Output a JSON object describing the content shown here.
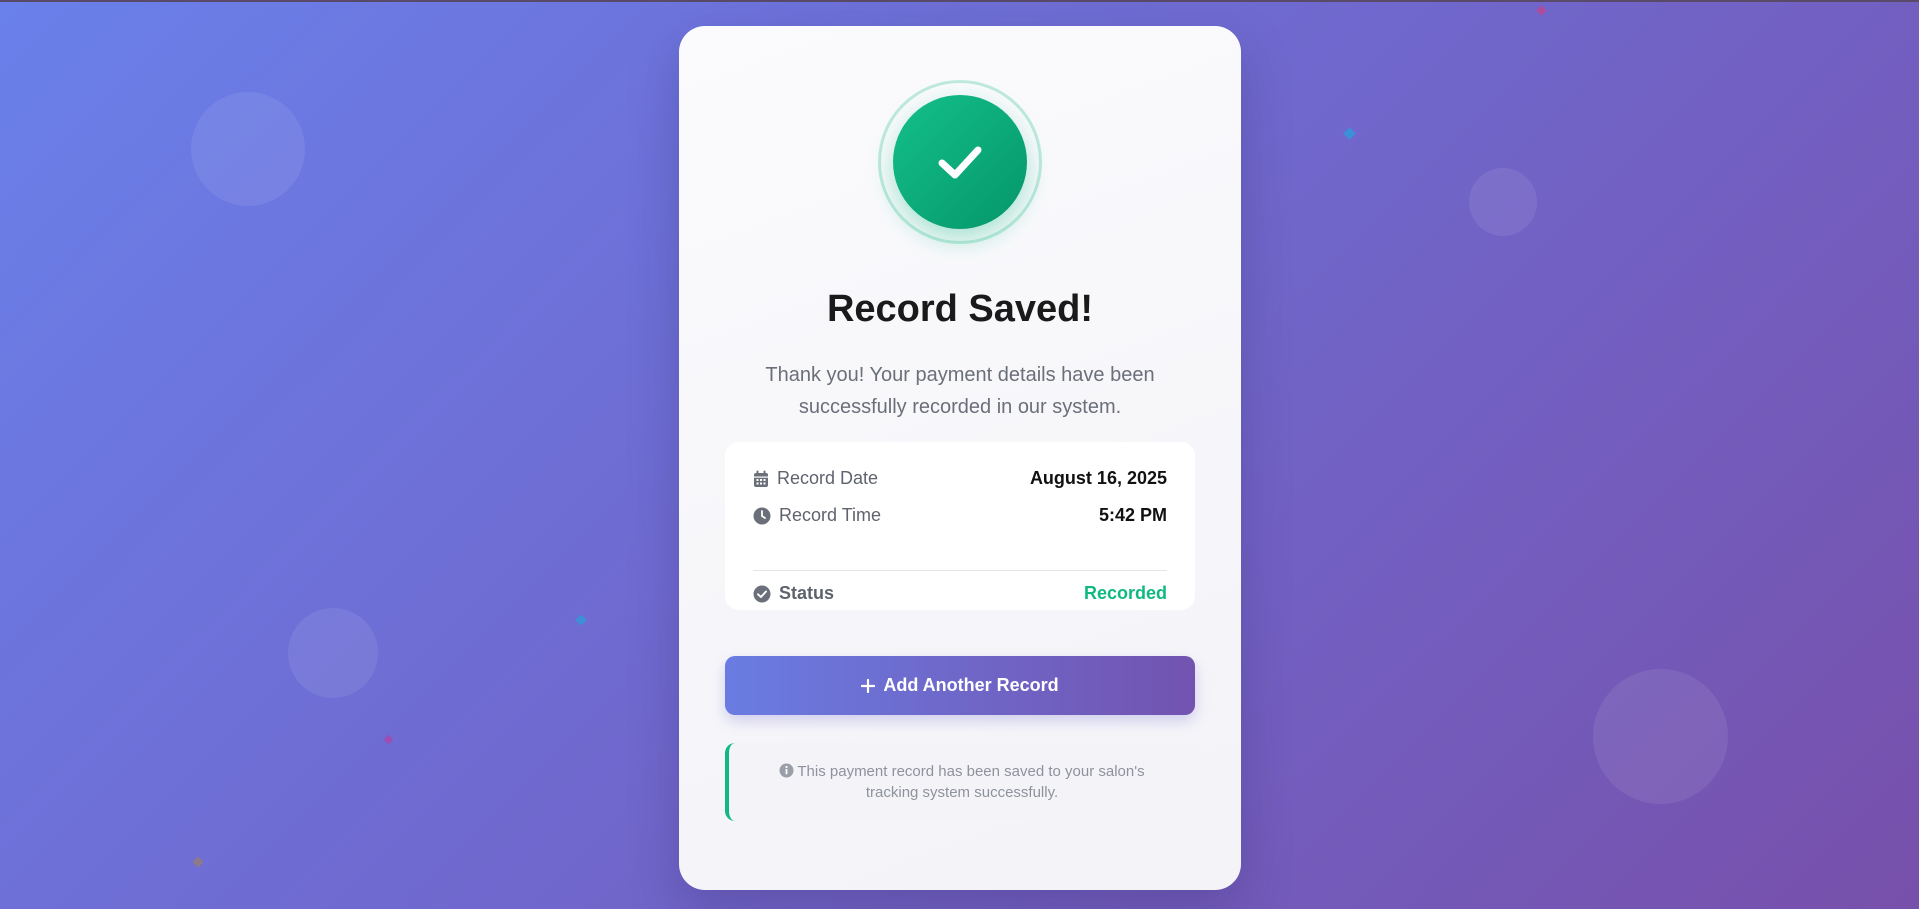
{
  "card": {
    "title": "Record Saved!",
    "description": "Thank you! Your payment details have been successfully recorded in our system."
  },
  "details": {
    "rows": [
      {
        "label": "Record Date",
        "value": "August 16, 2025",
        "icon": "calendar-icon"
      },
      {
        "label": "Record Time",
        "value": "5:42 PM",
        "icon": "clock-icon"
      },
      {
        "label": "Status",
        "value": "Recorded",
        "icon": "check-circle-icon"
      }
    ]
  },
  "actions": {
    "add_another_label": "Add Another Record"
  },
  "note": {
    "text": "This payment record has been saved to your salon's tracking system successfully."
  },
  "colors": {
    "success": "#10b981",
    "button_start": "#6a7ce2",
    "button_end": "#7353b0",
    "background_start": "#6a80ea",
    "background_end": "#7750ab"
  }
}
